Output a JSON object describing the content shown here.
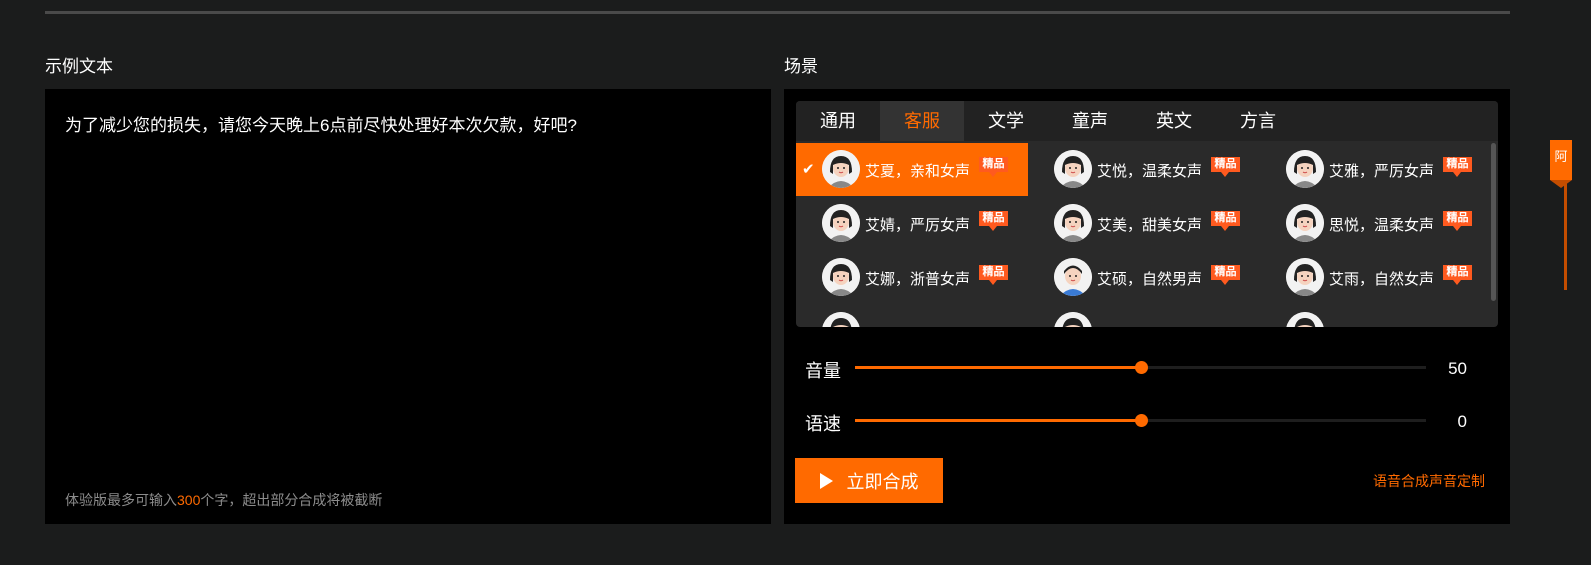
{
  "left": {
    "title": "示例文本",
    "sample_text": "为了减少您的损失，请您今天晚上6点前尽快处理好本次欠款，好吧?",
    "hint_prefix": "体验版最多可输入",
    "hint_number": "300",
    "hint_suffix": "个字，超出部分合成将被截断"
  },
  "right": {
    "title": "场景",
    "tabs": [
      {
        "label": "通用",
        "active": false
      },
      {
        "label": "客服",
        "active": true
      },
      {
        "label": "文学",
        "active": false
      },
      {
        "label": "童声",
        "active": false
      },
      {
        "label": "英文",
        "active": false
      },
      {
        "label": "方言",
        "active": false
      }
    ],
    "badge_label": "精品",
    "voices": [
      {
        "name": "艾夏，亲和女声",
        "selected": true,
        "gender": "female"
      },
      {
        "name": "艾悦，温柔女声",
        "selected": false,
        "gender": "female"
      },
      {
        "name": "艾雅，严厉女声",
        "selected": false,
        "gender": "female"
      },
      {
        "name": "艾婧，严厉女声",
        "selected": false,
        "gender": "female"
      },
      {
        "name": "艾美，甜美女声",
        "selected": false,
        "gender": "female"
      },
      {
        "name": "思悦，温柔女声",
        "selected": false,
        "gender": "female"
      },
      {
        "name": "艾娜，浙普女声",
        "selected": false,
        "gender": "female"
      },
      {
        "name": "艾硕，自然男声",
        "selected": false,
        "gender": "male"
      },
      {
        "name": "艾雨，自然女声",
        "selected": false,
        "gender": "female"
      },
      {
        "name": "",
        "selected": false,
        "gender": "female"
      },
      {
        "name": "",
        "selected": false,
        "gender": "female"
      },
      {
        "name": "",
        "selected": false,
        "gender": "female"
      }
    ],
    "volume": {
      "label": "音量",
      "value": "50",
      "fraction": 0.5
    },
    "speed": {
      "label": "语速",
      "value": "0",
      "fraction": 0.5
    },
    "synth_button": "立即合成",
    "custom_link": "语音合成声音定制"
  },
  "side_tab_label": "阿",
  "colors": {
    "accent": "#ff6a00",
    "badge": "#ff5a1f"
  }
}
